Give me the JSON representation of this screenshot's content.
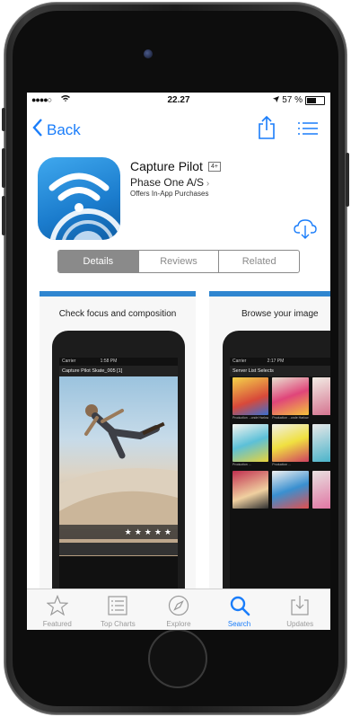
{
  "status_bar": {
    "signal": "●●●●○",
    "time": "22.27",
    "battery_text": "57 %",
    "battery_level": 0.57
  },
  "nav": {
    "back_label": "Back"
  },
  "app": {
    "name": "Capture Pilot",
    "age_rating": "4+",
    "developer": "Phase One A/S",
    "iap_note": "Offers In-App Purchases"
  },
  "segments": {
    "details": "Details",
    "reviews": "Reviews",
    "related": "Related",
    "selected": "details"
  },
  "screenshots": {
    "first": {
      "caption": "Check focus and composition",
      "status_left": "Carrier",
      "status_time": "1:58 PM",
      "nav_text": "Capture Pilot  Skate_005 [1]",
      "stars": "★★★★★"
    },
    "second": {
      "caption": "Browse your image",
      "status_left": "Carrier",
      "status_time": "2:17 PM",
      "nav_text": "Server List    Selects",
      "thumb_labels": [
        "Production ...onde Harlow",
        "Production ...onde Harlow",
        "",
        "Production ...",
        "Production ...",
        "",
        "",
        "",
        ""
      ]
    }
  },
  "tabs": {
    "featured": "Featured",
    "top_charts": "Top Charts",
    "explore": "Explore",
    "search": "Search",
    "updates": "Updates"
  },
  "colors": {
    "accent": "#1a7dfa",
    "segment_selected": "#8a8a8a",
    "screenshot_bar": "#2f86d0"
  }
}
